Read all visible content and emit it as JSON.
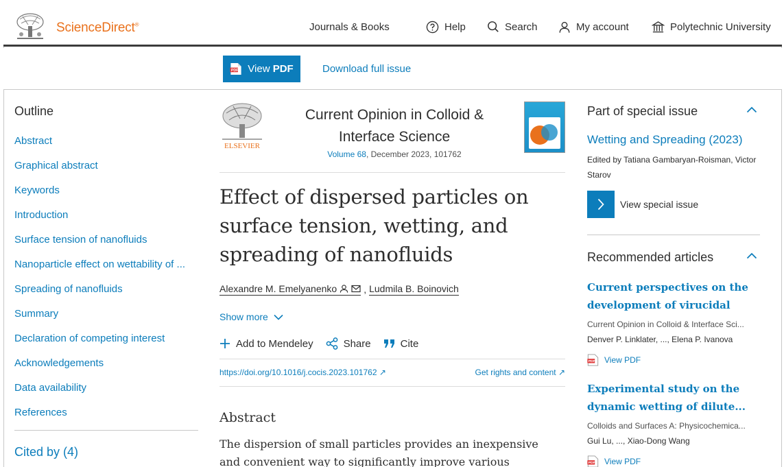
{
  "header": {
    "brand": "ScienceDirect",
    "brand_mark": "®",
    "nav": {
      "journals": "Journals & Books",
      "help": "Help",
      "search": "Search",
      "account": "My account",
      "institution": "Polytechnic University"
    }
  },
  "toolbar": {
    "view_prefix": "View",
    "view_pdf": "PDF",
    "download_issue": "Download full issue"
  },
  "outline": {
    "title": "Outline",
    "items": [
      "Abstract",
      "Graphical abstract",
      "Keywords",
      "Introduction",
      "Surface tension of nanofluids",
      "Nanoparticle effect on wettability of ...",
      "Spreading of nanofluids",
      "Summary",
      "Declaration of competing interest",
      "Acknowledgements",
      "Data availability",
      "References"
    ],
    "cited_by": "Cited by (4)"
  },
  "journal": {
    "title": "Current Opinion in Colloid & Interface Science",
    "volume": "Volume 68",
    "details": ", December 2023, 101762",
    "publisher_logo_text": "ELSEVIER"
  },
  "article": {
    "title": "Effect of dispersed particles on surface tension, wetting, and spreading of nanofluids",
    "author1": "Alexandre M. Emelyanenko",
    "separator": ",",
    "author2": "Ludmila B. Boinovich",
    "show_more": "Show more",
    "actions": {
      "mendeley": "Add to Mendeley",
      "share": "Share",
      "cite": "Cite"
    },
    "doi": "https://doi.org/10.1016/j.cocis.2023.101762",
    "rights": "Get rights and content",
    "abstract_heading": "Abstract",
    "abstract_text": "The dispersion of small particles provides an inexpensive and convenient way to significantly improve various functional"
  },
  "special_issue": {
    "heading": "Part of special issue",
    "name": "Wetting and Spreading (2023)",
    "edited_by": "Edited by Tatiana Gambaryan-Roisman, Victor Starov",
    "view_label": "View special issue"
  },
  "recommended": {
    "heading": "Recommended articles",
    "items": [
      {
        "title": "Current perspectives on the development of virucidal nano...",
        "source": "Current Opinion in Colloid & Interface Sci...",
        "authors": "Denver P. Linklater, ..., Elena P. Ivanova",
        "pdf": "View PDF"
      },
      {
        "title": "Experimental study on the dynamic wetting of dilute...",
        "source": "Colloids and Surfaces A: Physicochemica...",
        "authors": "Gui Lu, ..., Xiao-Dong Wang",
        "pdf": "View PDF"
      }
    ]
  },
  "colors": {
    "accent": "#0c7dbb",
    "brand": "#e9711c",
    "text": "#2e2e2e"
  }
}
